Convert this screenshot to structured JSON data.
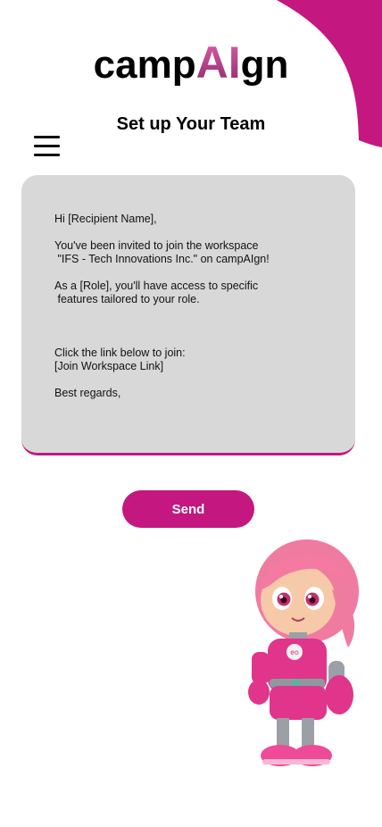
{
  "header": {
    "logo_prefix": "camp",
    "logo_ai": "AI",
    "logo_suffix": "gn",
    "page_title": "Set up Your Team"
  },
  "invite_card": {
    "message": "Hi [Recipient Name],\n\nYou've been invited to join the workspace\n \"IFS - Tech Innovations Inc.\" on campAIgn!\n\nAs a [Role], you'll have access to specific\n features tailored to your role.\n\n\n\nClick the link below to join:\n[Join Workspace Link]\n\nBest regards,"
  },
  "actions": {
    "send_label": "Send"
  },
  "colors": {
    "accent": "#c4177f",
    "card_background": "#d8d8d8"
  },
  "icons": {
    "menu": "hamburger-menu-icon"
  }
}
